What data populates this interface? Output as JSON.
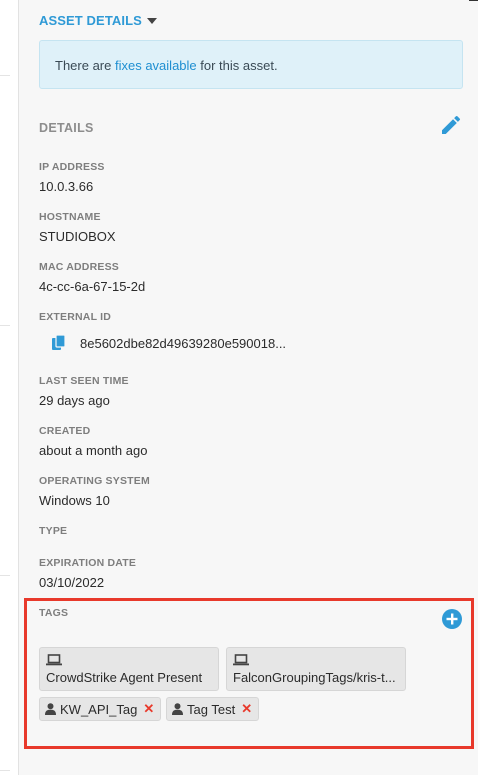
{
  "asset_details": {
    "header": "ASSET DETAILS",
    "notice": {
      "prefix": "There are ",
      "link": "fixes available",
      "suffix": " for this asset."
    }
  },
  "details": {
    "title": "DETAILS",
    "fields": {
      "ip_address": {
        "label": "IP ADDRESS",
        "value": "10.0.3.66"
      },
      "hostname": {
        "label": "HOSTNAME",
        "value": "STUDIOBOX"
      },
      "mac_address": {
        "label": "MAC ADDRESS",
        "value": "4c-cc-6a-67-15-2d"
      },
      "external_id": {
        "label": "EXTERNAL ID",
        "value": "8e5602dbe82d49639280e590018..."
      },
      "last_seen_time": {
        "label": "LAST SEEN TIME",
        "value": "29 days ago"
      },
      "created": {
        "label": "CREATED",
        "value": "about a month ago"
      },
      "operating_system": {
        "label": "OPERATING SYSTEM",
        "value": "Windows 10"
      },
      "type": {
        "label": "TYPE",
        "value": ""
      },
      "expiration_date": {
        "label": "EXPIRATION DATE",
        "value": "03/10/2022"
      }
    }
  },
  "tags": {
    "title": "TAGS",
    "source_tags": [
      {
        "label": "CrowdStrike Agent Present",
        "icon": "laptop-icon"
      },
      {
        "label": "FalconGroupingTags/kris-t...",
        "icon": "laptop-icon"
      }
    ],
    "user_tags": [
      {
        "label": "KW_API_Tag",
        "icon": "person-icon"
      },
      {
        "label": "Tag Test",
        "icon": "person-icon"
      }
    ],
    "remove_glyph": "✕"
  },
  "colors": {
    "accent": "#2f9ad6",
    "highlight_border": "#e8392b",
    "remove": "#e8392b",
    "info_bg": "#dff1f9"
  }
}
